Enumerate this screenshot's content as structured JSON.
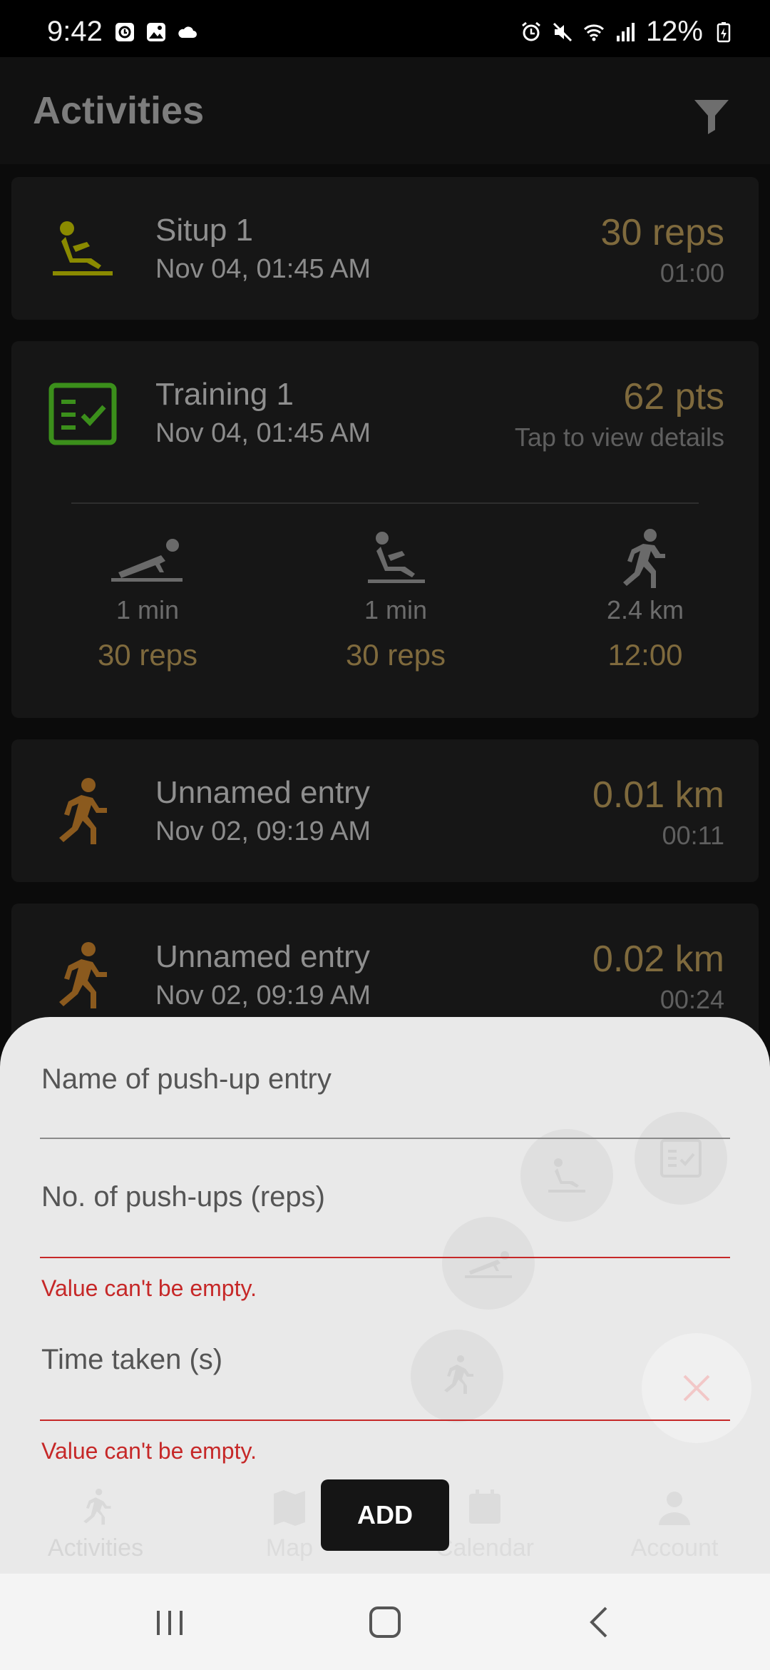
{
  "status_bar": {
    "time": "9:42",
    "battery": "12%",
    "left_icons": [
      "clock-app-icon",
      "gallery-icon",
      "cloud-icon"
    ],
    "right_icons": [
      "alarm-icon",
      "mute-icon",
      "wifi-icon",
      "signal-icon",
      "battery-charging-icon"
    ]
  },
  "app_bar": {
    "title": "Activities",
    "filter_icon": "filter-icon"
  },
  "activities": [
    {
      "name": "Situp 1",
      "date": "Nov 04, 01:45 AM",
      "value": "30 reps",
      "sub": "01:00",
      "icon": "situp-icon",
      "icon_color": "#8a8a00"
    },
    {
      "name": "Training 1",
      "date": "Nov 04, 01:45 AM",
      "value": "62 pts",
      "sub": "Tap to view details",
      "icon": "checklist-icon",
      "icon_color": "#3b8f1b",
      "breakdown": [
        {
          "icon": "pushup-icon",
          "duration": "1 min",
          "value": "30 reps"
        },
        {
          "icon": "situp-icon",
          "duration": "1 min",
          "value": "30 reps"
        },
        {
          "icon": "run-icon",
          "duration": "2.4 km",
          "value": "12:00"
        }
      ]
    },
    {
      "name": "Unnamed entry",
      "date": "Nov 02, 09:19 AM",
      "value": "0.01 km",
      "sub": "00:11",
      "icon": "run-icon",
      "icon_color": "#8b5a1e"
    },
    {
      "name": "Unnamed entry",
      "date": "Nov 02, 09:19 AM",
      "value": "0.02 km",
      "sub": "00:24",
      "icon": "run-icon",
      "icon_color": "#8b5a1e"
    }
  ],
  "bottom_nav": [
    {
      "label": "Activities",
      "icon": "run-icon"
    },
    {
      "label": "Map",
      "icon": "map-icon"
    },
    {
      "label": "Calendar",
      "icon": "calendar-icon"
    },
    {
      "label": "Account",
      "icon": "account-icon"
    }
  ],
  "form": {
    "name_label": "Name of push-up entry",
    "reps_label": "No. of push-ups (reps)",
    "reps_error": "Value can't be empty.",
    "time_label": "Time taken (s)",
    "time_error": "Value can't be empty.",
    "submit_label": "ADD"
  },
  "colors": {
    "accent_value": "#7f6a3d",
    "error": "#c62828",
    "sheet_bg": "#e9e9e9"
  }
}
